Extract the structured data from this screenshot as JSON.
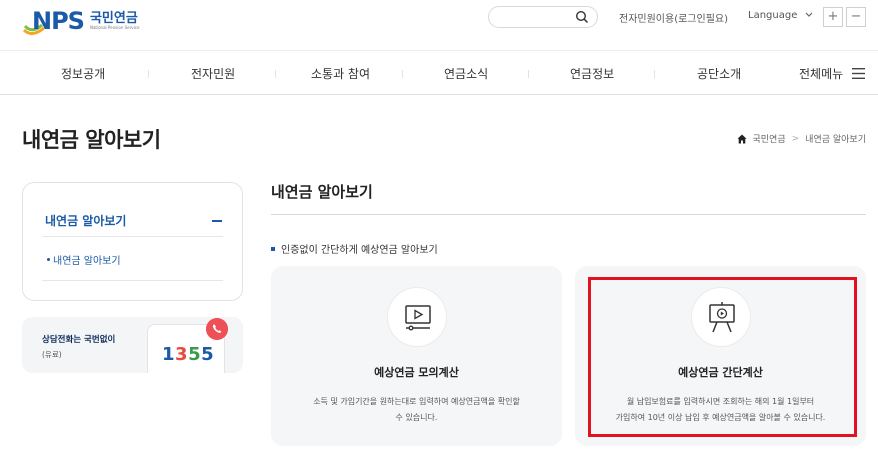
{
  "header": {
    "logo_mark": "NPS",
    "logo_name_ko": "국민연금",
    "logo_name_en": "National Pension Service",
    "search": {
      "placeholder": "",
      "value": ""
    },
    "top_link": "전자민원이용(로그인필요)",
    "language_label": "Language",
    "zoom_in": "+",
    "zoom_out": "−"
  },
  "gnb": {
    "items": [
      {
        "label": "정보공개"
      },
      {
        "label": "전자민원"
      },
      {
        "label": "소통과 참여"
      },
      {
        "label": "연금소식"
      },
      {
        "label": "연금정보"
      },
      {
        "label": "공단소개"
      },
      {
        "label": "전체메뉴"
      }
    ]
  },
  "page": {
    "title": "내연금 알아보기",
    "breadcrumb": [
      "국민연금",
      "내연금 알아보기"
    ],
    "breadcrumb_sep": ">"
  },
  "sidebar": {
    "title": "내연금 알아보기",
    "sub_items": [
      {
        "label": "내연금 알아보기"
      }
    ],
    "call": {
      "title": "상담전화는 국번없이",
      "sub": "(유료)",
      "digits": [
        "1",
        "3",
        "5",
        "5"
      ]
    }
  },
  "content": {
    "section_title": "내연금 알아보기",
    "lead": "인증없이 간단하게 예상연금 알아보기",
    "cards": [
      {
        "icon": "monitor-play-icon",
        "title": "예상연금 모의계산",
        "desc_line1": "소득 및 가입기간을 원하는대로 입력하여 예상연금액을 확인할",
        "desc_line2": "수 있습니다."
      },
      {
        "icon": "presentation-board-icon",
        "title": "예상연금 간단계산",
        "desc_line1": "월 납입보험료를 입력하시면 조회하는 해의 1월 1일부터",
        "desc_line2": "가입하여 10년 이상 납입 후 예상연금액을 알아볼 수 있습니다.",
        "highlighted": true
      }
    ]
  },
  "colors": {
    "brand_blue": "#1b5aa6",
    "highlight_red": "#e3121f",
    "card_bg": "#f5f6f8"
  }
}
